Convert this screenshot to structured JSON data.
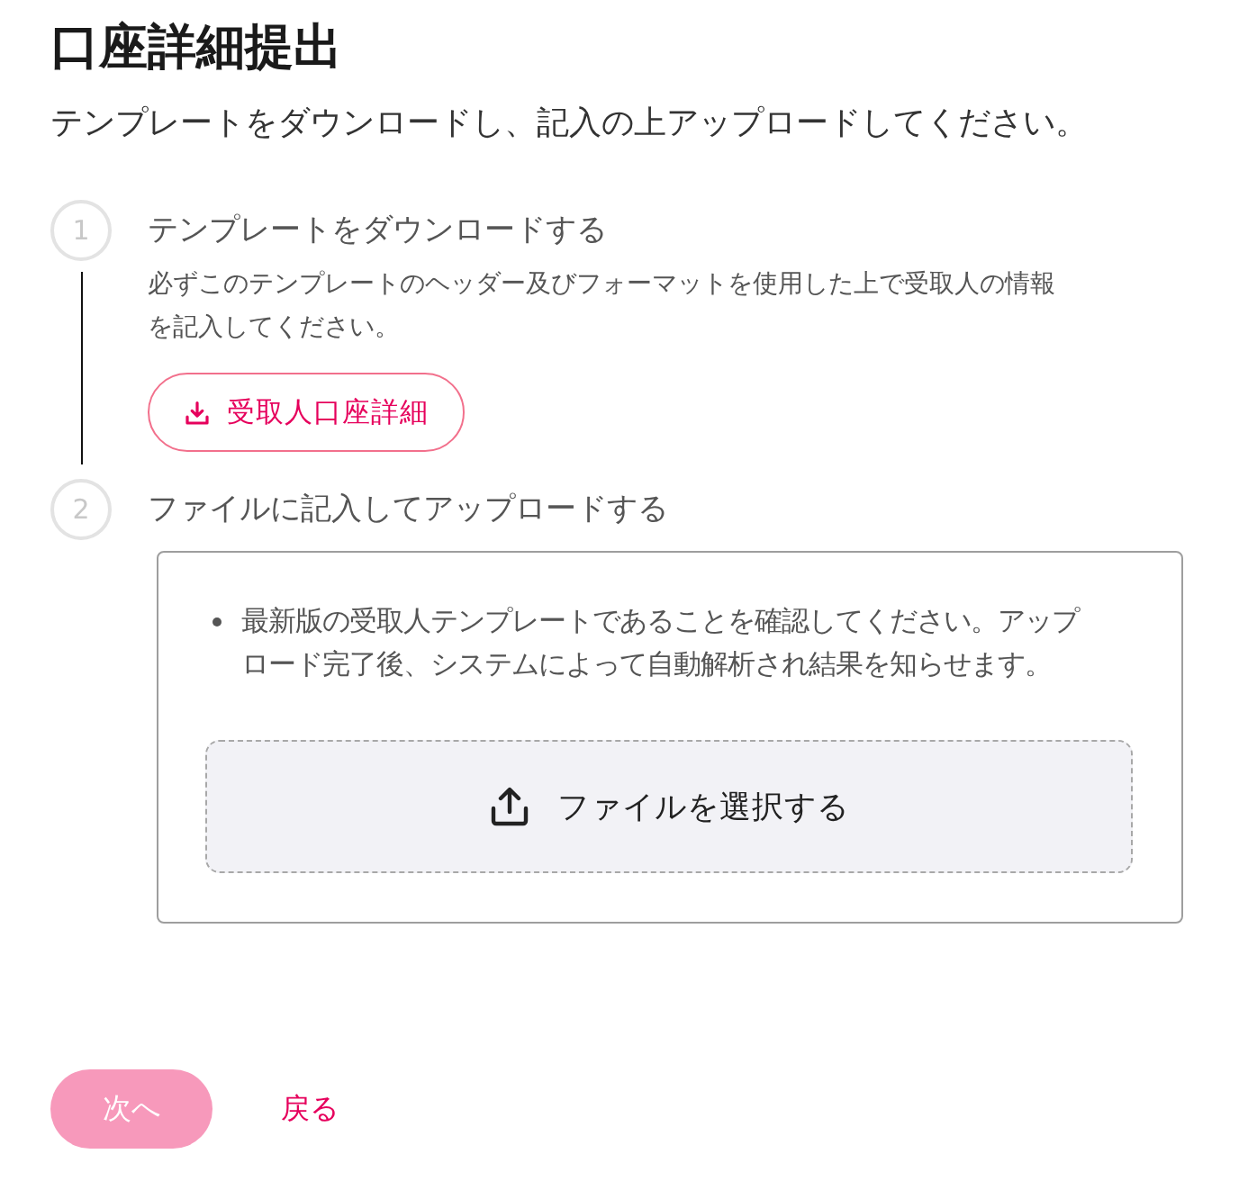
{
  "header": {
    "title": "口座詳細提出",
    "subtitle": "テンプレートをダウンロードし、記入の上アップロードしてください。"
  },
  "steps": [
    {
      "kind": "download",
      "number": "1",
      "title": "テンプレートをダウンロードする",
      "description": "必ずこのテンプレートのヘッダー及びフォーマットを使用した上で受取人の情報を記入してください。",
      "button": {
        "label": "受取人口座詳細"
      }
    },
    {
      "kind": "upload",
      "number": "2",
      "title": "ファイルに記入してアップロードする",
      "notes": [
        "最新版の受取人テンプレートであることを確認してください。アップロード完了後、システムによって自動解析され結果を知らせます。"
      ],
      "dropzone": {
        "label": "ファイルを選択する"
      }
    }
  ],
  "footer": {
    "next_button": {
      "label": "次へ",
      "disabled": true
    },
    "back_link": {
      "label": "戻る"
    }
  }
}
